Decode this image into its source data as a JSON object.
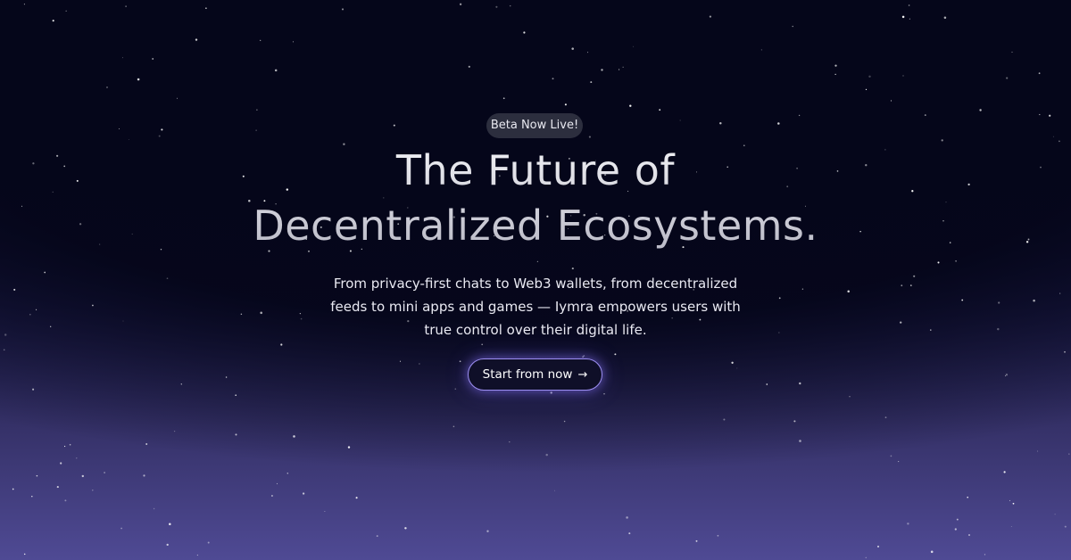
{
  "hero": {
    "badge": "Beta Now Live!",
    "title_line1": "The Future of",
    "title_line2": "Decentralized Ecosystems.",
    "subtitle_line1": "From privacy-first chats to Web3 wallets, from decentralized",
    "subtitle_line2": "feeds to mini apps and games — Iymra empowers users with",
    "subtitle_line3": "true control over their digital life.",
    "cta_label": "Start from now",
    "cta_icon": "→"
  },
  "colors": {
    "background_top": "#05061a",
    "background_bottom": "#4f4a94",
    "cta_border": "#9d8ff2",
    "badge_bg": "#2c2e3e"
  },
  "icons": {
    "cta_icon_name": "arrow-right-icon"
  }
}
